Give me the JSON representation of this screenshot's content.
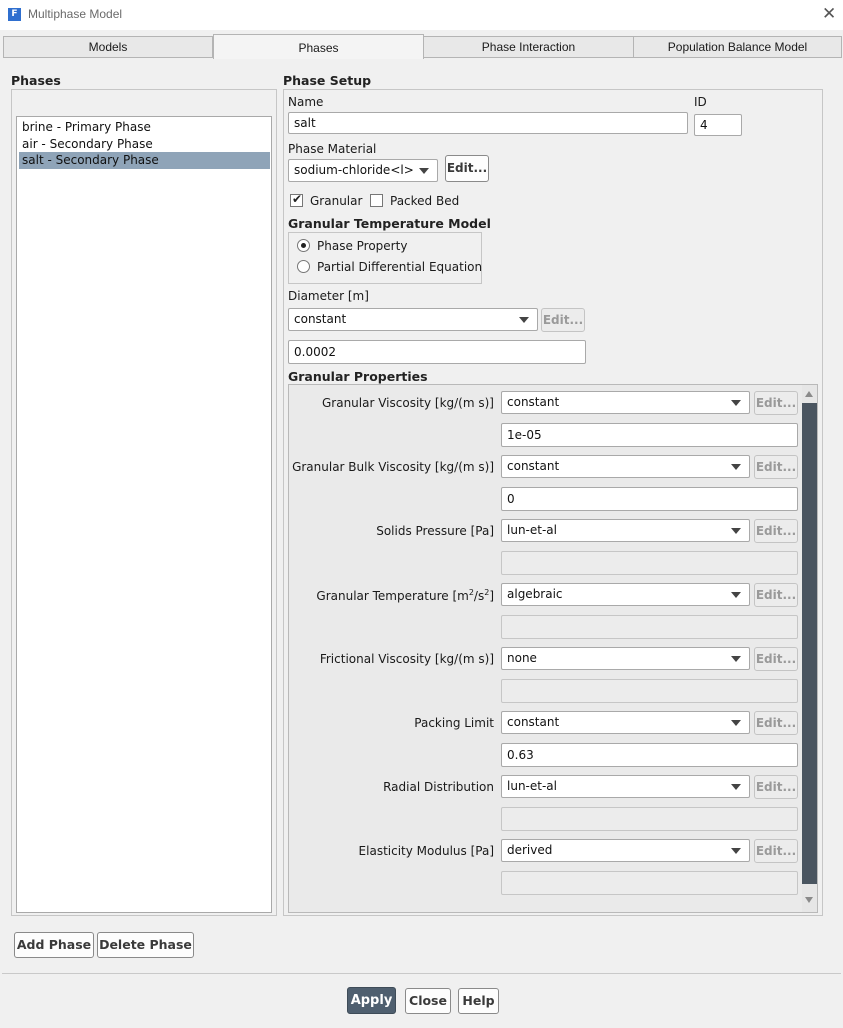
{
  "window": {
    "title": "Multiphase Model",
    "icon_letter": "F",
    "close_glyph": "✕"
  },
  "tabs": [
    {
      "label": "Models"
    },
    {
      "label": "Phases"
    },
    {
      "label": "Phase Interaction"
    },
    {
      "label": "Population Balance Model"
    }
  ],
  "phases": {
    "title": "Phases",
    "items": [
      {
        "label": "brine - Primary Phase"
      },
      {
        "label": "air - Secondary Phase"
      },
      {
        "label": "salt - Secondary Phase",
        "selected": true
      }
    ],
    "add_label": "Add Phase",
    "delete_label": "Delete Phase"
  },
  "setup": {
    "title": "Phase Setup",
    "name_label": "Name",
    "name_value": "salt",
    "id_label": "ID",
    "id_value": "4",
    "material_label": "Phase Material",
    "material_value": "sodium-chloride<l>",
    "edit_label": "Edit...",
    "granular_label": "Granular",
    "granular_checked": true,
    "packed_bed_label": "Packed Bed",
    "packed_bed_checked": false,
    "gtm_title": "Granular Temperature Model",
    "gtm_options": [
      {
        "label": "Phase Property",
        "selected": true
      },
      {
        "label": "Partial Differential Equation",
        "selected": false
      }
    ],
    "diameter_label": "Diameter [m]",
    "diameter_method": "constant",
    "diameter_value": "0.0002"
  },
  "granular_properties": {
    "title": "Granular Properties",
    "rows": [
      {
        "label_pre": "Granular Viscosity [kg/(m s)]",
        "method": "constant",
        "value": "1e-05"
      },
      {
        "label_pre": "Granular Bulk Viscosity [kg/(m s)]",
        "method": "constant",
        "value": "0"
      },
      {
        "label_pre": "Solids Pressure [Pa]",
        "method": "lun-et-al",
        "value": ""
      },
      {
        "label_pre": "Granular Temperature [m",
        "sup1": "2",
        "label_mid": "/s",
        "sup2": "2",
        "label_post": "]",
        "method": "algebraic",
        "value": ""
      },
      {
        "label_pre": "Frictional Viscosity [kg/(m s)]",
        "method": "none",
        "value": ""
      },
      {
        "label_pre": "Packing Limit",
        "method": "constant",
        "value": "0.63"
      },
      {
        "label_pre": "Radial Distribution",
        "method": "lun-et-al",
        "value": ""
      },
      {
        "label_pre": "Elasticity Modulus [Pa]",
        "method": "derived",
        "value": ""
      }
    ]
  },
  "footer": {
    "apply_label": "Apply",
    "close_label": "Close",
    "help_label": "Help"
  }
}
